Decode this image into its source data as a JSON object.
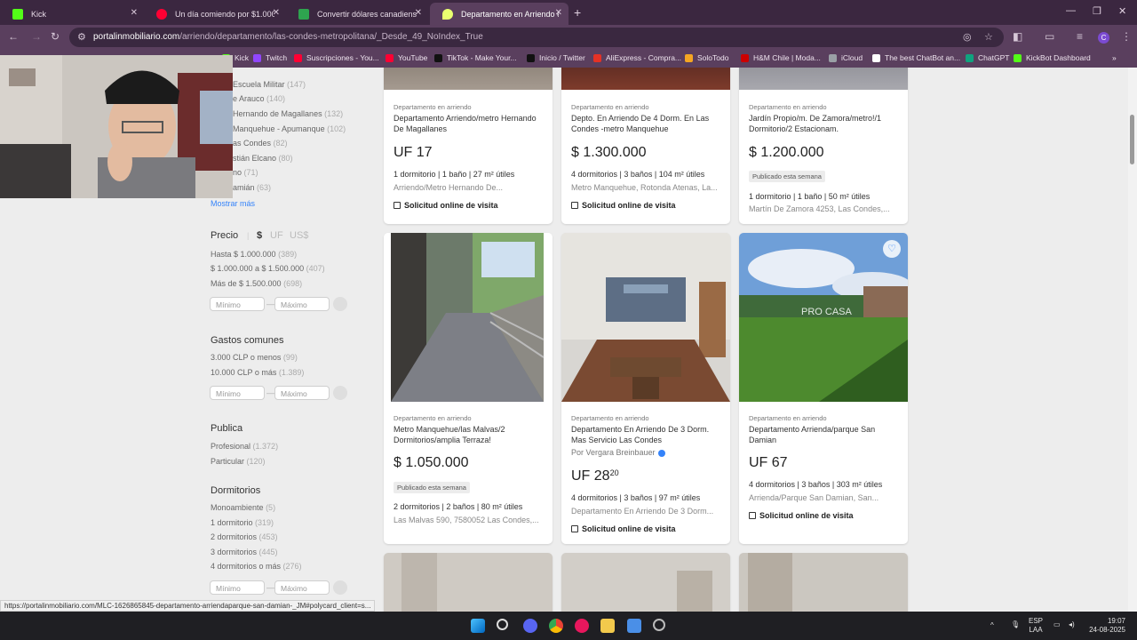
{
  "browser": {
    "tabs": [
      {
        "label": "Kick",
        "color": "#53fc18"
      },
      {
        "label": "Un día comiendo por $1.000 p",
        "color": "#ff0033"
      },
      {
        "label": "Convertir dólares canadienses a",
        "color": "#2ea44f"
      },
      {
        "label": "Departamento en Arriendo en l",
        "color": "#e9ff70"
      }
    ],
    "url_host": "portalinmobiliario.com",
    "url_path": "/arriendo/departamento/las-condes-metropolitana/_Desde_49_NoIndex_True",
    "bookmarks": [
      {
        "label": "Kick",
        "color": "#53fc18"
      },
      {
        "label": "Twitch",
        "color": "#9146ff"
      },
      {
        "label": "Suscripciones - You...",
        "color": "#ff0033"
      },
      {
        "label": "YouTube",
        "color": "#ff0033"
      },
      {
        "label": "TikTok - Make Your...",
        "color": "#111111"
      },
      {
        "label": "Inicio / Twitter",
        "color": "#111111"
      },
      {
        "label": "AliExpress - Compra...",
        "color": "#e43225"
      },
      {
        "label": "SoloTodo",
        "color": "#f5a623"
      },
      {
        "label": "H&M Chile | Moda...",
        "color": "#cc0000"
      },
      {
        "label": "iCloud",
        "color": "#9aa0a6"
      },
      {
        "label": "The best ChatBot an...",
        "color": "#ffffff"
      },
      {
        "label": "ChatGPT",
        "color": "#10a37f"
      },
      {
        "label": "KickBot Dashboard",
        "color": "#53fc18"
      }
    ]
  },
  "sidebar": {
    "locations": [
      {
        "label": "Escuela Militar",
        "count": "(147)"
      },
      {
        "label": "e Arauco",
        "count": "(140)"
      },
      {
        "label": "Hernando de Magallanes",
        "count": "(132)"
      },
      {
        "label": "Manquehue - Apumanque",
        "count": "(102)"
      },
      {
        "label": "as Condes",
        "count": "(82)"
      },
      {
        "label": "stián Elcano",
        "count": "(80)"
      },
      {
        "label": "no",
        "count": "(71)"
      },
      {
        "label": "amián",
        "count": "(63)"
      }
    ],
    "show_more": "Mostrar más",
    "price": {
      "title": "Precio",
      "currencies": [
        "$",
        "UF",
        "US$"
      ],
      "options": [
        {
          "label": "Hasta $ 1.000.000",
          "count": "(389)"
        },
        {
          "label": "$ 1.000.000 a $ 1.500.000",
          "count": "(407)"
        },
        {
          "label": "Más de $ 1.500.000",
          "count": "(698)"
        }
      ]
    },
    "expenses": {
      "title": "Gastos comunes",
      "options": [
        {
          "label": "3.000 CLP o menos",
          "count": "(99)"
        },
        {
          "label": "10.000 CLP o más",
          "count": "(1.389)"
        }
      ]
    },
    "publisher": {
      "title": "Publica",
      "options": [
        {
          "label": "Profesional",
          "count": "(1.372)"
        },
        {
          "label": "Particular",
          "count": "(120)"
        }
      ]
    },
    "bedrooms": {
      "title": "Dormitorios",
      "options": [
        {
          "label": "Monoambiente",
          "count": "(5)"
        },
        {
          "label": "1 dormitorio",
          "count": "(319)"
        },
        {
          "label": "2 dormitorios",
          "count": "(453)"
        },
        {
          "label": "3 dormitorios",
          "count": "(445)"
        },
        {
          "label": "4 dormitorios o más",
          "count": "(276)"
        }
      ]
    },
    "min_placeholder": "Mínimo",
    "max_placeholder": "Máximo"
  },
  "listings_row1": [
    {
      "type": "Departamento en arriendo",
      "title": "Departamento Arriendo/metro Hernando De Magallanes",
      "price": "UF 17",
      "attrs": "1 dormitorio | 1 baño | 27 m² útiles",
      "addr": "Arriendo/Metro Hernando De...",
      "visit": "Solicitud online de visita"
    },
    {
      "type": "Departamento en arriendo",
      "title": "Depto. En Arriendo De 4 Dorm. En Las Condes -metro Manquehue",
      "price": "$ 1.300.000",
      "attrs": "4 dormitorios | 3 baños | 104 m² útiles",
      "addr": "Metro Manquehue, Rotonda Atenas, La...",
      "visit": "Solicitud online de visita"
    },
    {
      "type": "Departamento en arriendo",
      "title": "Jardín Propio/m. De Zamora/metro!/1 Dormitorio/2 Estacionam.",
      "price": "$ 1.200.000",
      "badge": "Publicado esta semana",
      "attrs": "1 dormitorio | 1 baño | 50 m² útiles",
      "addr": "Martín De Zamora 4253, Las Condes,..."
    }
  ],
  "listings_row2": [
    {
      "type": "Departamento en arriendo",
      "title": "Metro Manquehue/las Malvas/2 Dormitorios/amplia Terraza!",
      "price": "$ 1.050.000",
      "badge": "Publicado esta semana",
      "attrs": "2 dormitorios | 2 baños | 80 m² útiles",
      "addr": "Las Malvas 590, 7580052 Las Condes,..."
    },
    {
      "type": "Departamento en arriendo",
      "title": "Departamento En Arriendo De 3 Dorm. Mas Servicio Las Condes",
      "seller": "Por Vergara Breinbauer",
      "price": "UF 28",
      "price_dec": "20",
      "attrs": "4 dormitorios | 3 baños | 97 m² útiles",
      "addr": "Departamento En Arriendo De 3 Dorm...",
      "visit": "Solicitud online de visita"
    },
    {
      "type": "Departamento en arriendo",
      "title": "Departamento Arrienda/parque San Damian",
      "price": "UF 67",
      "attrs": "4 dormitorios | 3 baños | 303 m² útiles",
      "addr": "Arrienda/Parque San Damian, San...",
      "visit": "Solicitud online de visita",
      "watermark": "PRO CASA"
    }
  ],
  "status_url": "https://portalinmobiliario.com/MLC-1626865845-departamento-arriendaparque-san-damian-_JM#polycard_client=s...",
  "taskbar": {
    "lang": "ESP",
    "lang2": "LAA",
    "time": "19:07",
    "date": "24-08-2025"
  }
}
